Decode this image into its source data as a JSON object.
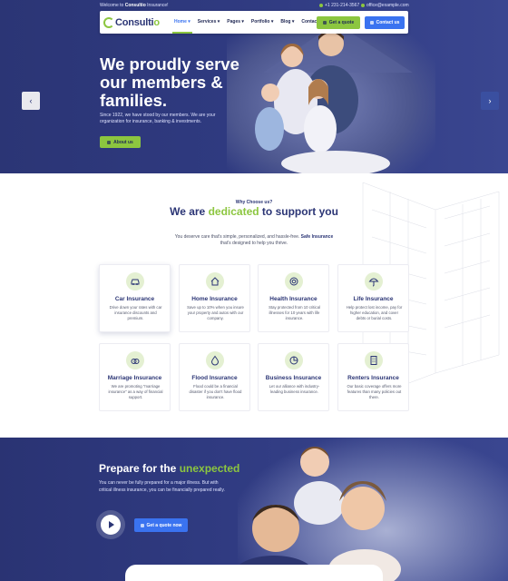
{
  "topbar": {
    "welcome_prefix": "Welcome to ",
    "welcome_brand": "Consultio",
    "welcome_suffix": " Insurance!",
    "phone": "+1 231-214-3567",
    "email": "office@example.com"
  },
  "navbar": {
    "logo_main": "Consulti",
    "logo_end": "o",
    "items": [
      "Home ▾",
      "Services ▾",
      "Pages ▾",
      "Portfolio ▾",
      "Blog ▾",
      "Contact"
    ],
    "quote_button": "Get a quote",
    "contact_button": "Contact us"
  },
  "hero": {
    "title": "We proudly serve our members & families.",
    "text": "Since 1922, we have stood by our members. We are your organization for insurance, banking & investments.",
    "about_button": "About us",
    "prev_arrow": "‹",
    "next_arrow": "›"
  },
  "services": {
    "eyebrow": "Why Choose us?",
    "title_pre": "We are ",
    "title_hl": "dedicated",
    "title_post": " to support you",
    "subtitle_pre": "You deserve care that's simple, personalized, and hassle-free. ",
    "subtitle_bold": "Safe Insurance",
    "subtitle_post": " that's designed to help you thrive.",
    "cards": [
      {
        "title": "Car Insurance",
        "desc": "Drive down your rates with car insurance discounts and premium.",
        "icon": "car-icon"
      },
      {
        "title": "Home Insurance",
        "desc": "Save up to 10% when you insure your property and autos with our company.",
        "icon": "home-icon"
      },
      {
        "title": "Health Insurance",
        "desc": "Stay protected from 10 critical illnesses for 10 years with life insurance.",
        "icon": "lifebuoy-icon"
      },
      {
        "title": "Life Insurance",
        "desc": "Help protect lost income, pay for higher education, and cover debts or burial costs.",
        "icon": "umbrella-icon"
      },
      {
        "title": "Marriage Insurance",
        "desc": "We are promoting \"marriage insurance\" as a way of financial support.",
        "icon": "rings-icon"
      },
      {
        "title": "Flood Insurance",
        "desc": "Flood could be a financial disaster if you don't have flood insurance.",
        "icon": "water-drop-icon"
      },
      {
        "title": "Business Insurance",
        "desc": "Let our alliance with industry-leading business insurance.",
        "icon": "pie-chart-icon"
      },
      {
        "title": "Renters Insurance",
        "desc": "Our basic coverage offers more features than many policies out there.",
        "icon": "building-icon"
      }
    ]
  },
  "cta": {
    "title_pre": "Prepare for the ",
    "title_hl": "unexpected",
    "text": "You can never be fully prepared for a major illness. But with critical illness insurance, you can be financially prepared really.",
    "button": "Get a quote now"
  },
  "colors": {
    "navy": "#2b3575",
    "green": "#8cc63f",
    "blue": "#3a73f0"
  }
}
